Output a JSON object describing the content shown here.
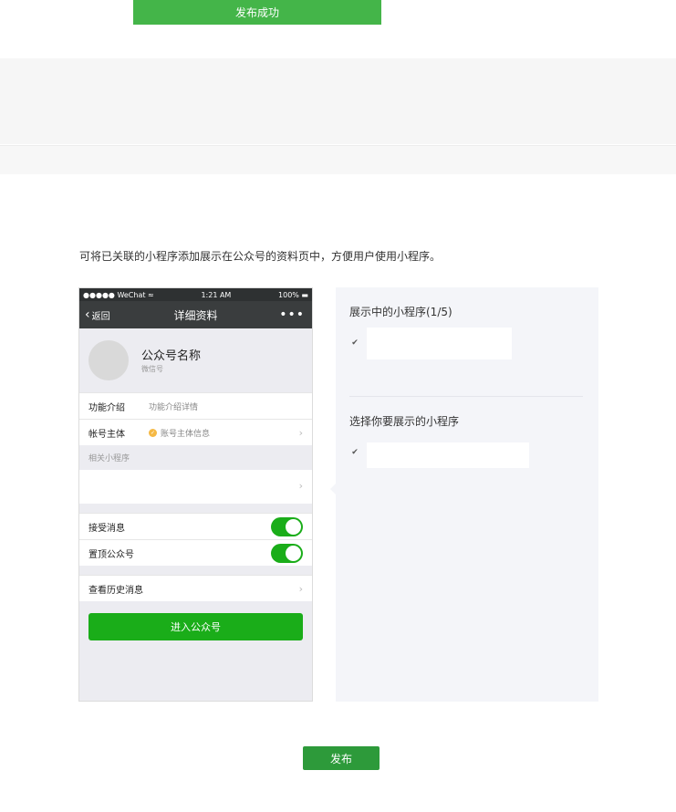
{
  "toast": {
    "text": "发布成功"
  },
  "description": "可将已关联的小程序添加展示在公众号的资料页中，方便用户使用小程序。",
  "phone": {
    "status": {
      "carrier": "●●●●● WeChat ≈",
      "time": "1:21 AM",
      "battery": "100%"
    },
    "nav": {
      "back": "返回",
      "title": "详细资料",
      "more": "•••"
    },
    "profile": {
      "name": "公众号名称",
      "wechat_id": "微信号"
    },
    "rows": [
      {
        "label": "功能介绍",
        "value": "功能介绍详情"
      },
      {
        "label": "帐号主体",
        "value": "账号主体信息"
      }
    ],
    "related_label": "相关小程序",
    "toggles": [
      {
        "label": "接受消息",
        "on": true
      },
      {
        "label": "置顶公众号",
        "on": true
      }
    ],
    "history": "查看历史消息",
    "enter_button": "进入公众号"
  },
  "panel": {
    "showing_title": "展示中的小程序(1/5)",
    "choose_title": "选择你要展示的小程序",
    "checkmark": "✔"
  },
  "publish_button": "发布",
  "colors": {
    "accent": "#44b549",
    "wechat_green": "#1aad19",
    "publish": "#2d9a3a"
  }
}
